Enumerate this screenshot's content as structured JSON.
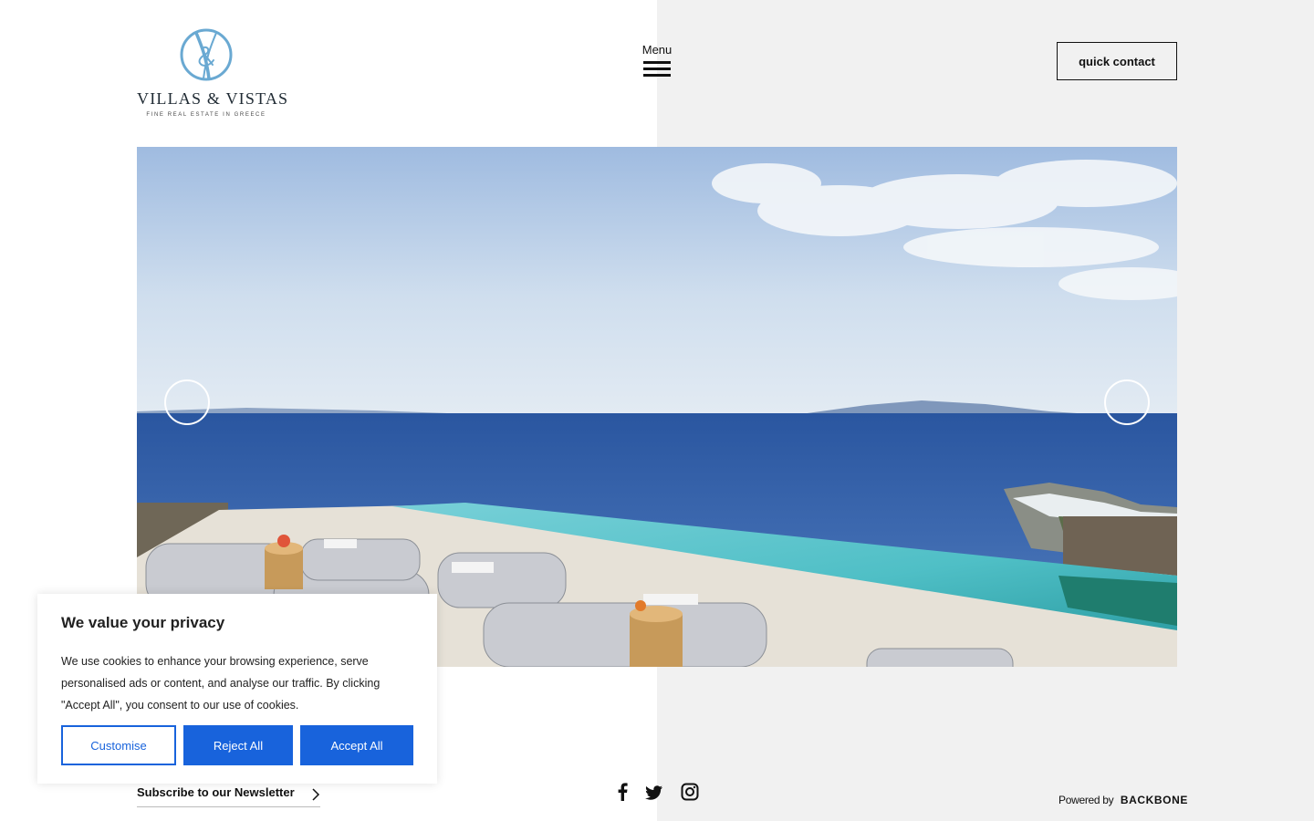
{
  "brand": {
    "name": "VILLAS & VISTAS",
    "tagline": "FINE REAL ESTATE IN GREECE",
    "accent": "#6aa9d2"
  },
  "header": {
    "menu_label": "Menu",
    "quick_contact_label": "quick contact"
  },
  "hero": {
    "prev_icon": "circle-arrow-left-icon",
    "next_icon": "circle-arrow-right-icon"
  },
  "footer": {
    "newsletter_label": "Subscribe to our Newsletter",
    "social": [
      "facebook-icon",
      "twitter-icon",
      "instagram-icon"
    ],
    "powered_prefix": "Powered by",
    "powered_brand": "BACKBONE"
  },
  "cookie_banner": {
    "title": "We value your privacy",
    "body": "We use cookies to enhance your browsing experience, serve personalised ads or content, and analyse our traffic. By clicking \"Accept All\", you consent to our use of cookies.",
    "customise_label": "Customise",
    "reject_label": "Reject All",
    "accept_label": "Accept All",
    "button_color": "#1863dc"
  }
}
